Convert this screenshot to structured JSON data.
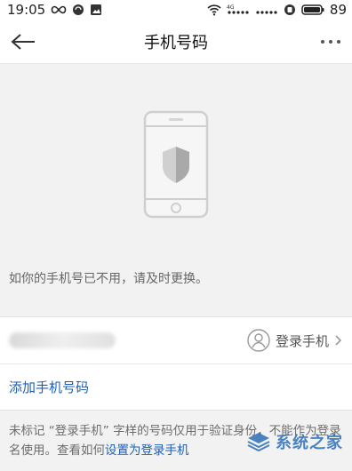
{
  "status_bar": {
    "time": "19:05",
    "battery": "89",
    "network": "4G"
  },
  "header": {
    "title": "手机号码"
  },
  "hero": {
    "icons": [
      "phone-icon",
      "shield-icon"
    ]
  },
  "tip": {
    "text": "如你的手机号已不用，请及时更换。"
  },
  "phone_list": {
    "login_label": "登录手机",
    "add_label": "添加手机号码"
  },
  "note": {
    "text_before": "未标记 “登录手机” 字样的号码仅用于验证身份，不能作为登录名使用。查看如何",
    "link": "设置为登录手机"
  },
  "watermark": {
    "text": "系统之家"
  },
  "colors": {
    "link": "#1e5fb3",
    "background": "#f2f2f2"
  }
}
